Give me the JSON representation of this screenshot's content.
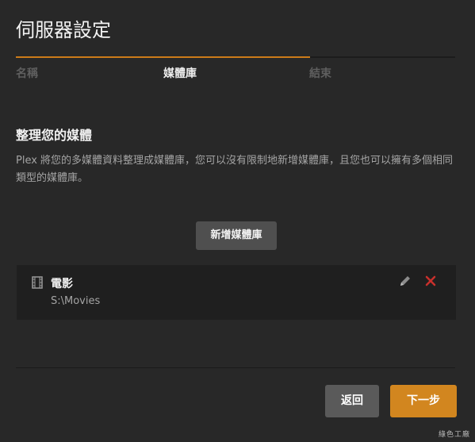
{
  "dialog": {
    "title": "伺服器設定"
  },
  "steps": {
    "progress": 0.67,
    "items": [
      {
        "label": "名稱",
        "active": false
      },
      {
        "label": "媒體庫",
        "active": true
      },
      {
        "label": "結束",
        "active": false
      }
    ]
  },
  "section": {
    "heading": "整理您的媒體",
    "description": "Plex 將您的多媒體資料整理成媒體庫，您可以沒有限制地新增媒體庫，且您也可以擁有多個相同類型的媒體庫。"
  },
  "add_library": {
    "label": "新增媒體庫"
  },
  "libraries": [
    {
      "icon": "film-icon",
      "name": "電影",
      "path": "S:\\Movies"
    }
  ],
  "footer": {
    "back_label": "返回",
    "next_label": "下一步"
  },
  "watermark": "綠色工廠",
  "colors": {
    "accent": "#cc7b19",
    "delete": "#c9302c",
    "background": "#282828"
  }
}
